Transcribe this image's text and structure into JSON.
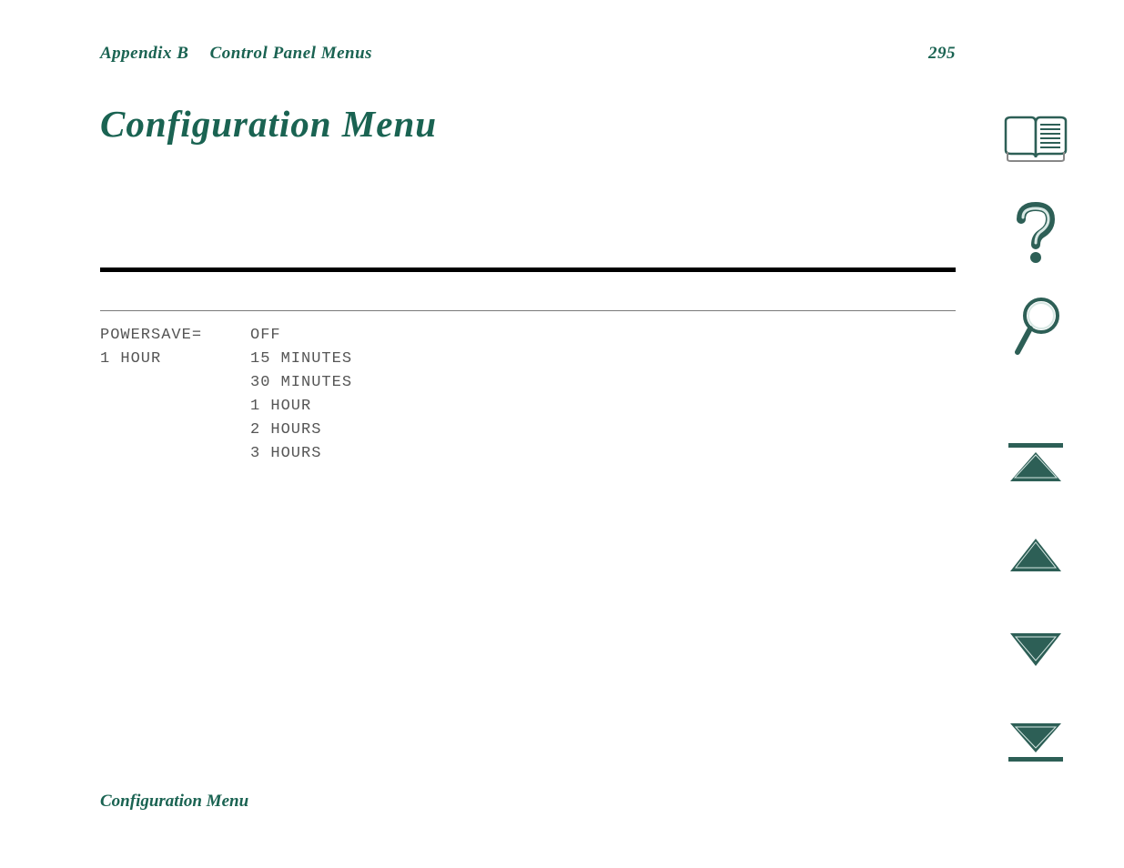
{
  "header": {
    "appendix": "Appendix B",
    "chapter": "Control Panel Menus",
    "page_number": "295"
  },
  "title": "Configuration Menu",
  "menu": {
    "setting_name": "POWERSAVE=",
    "current_value": "1 HOUR",
    "options": [
      "OFF",
      "15 MINUTES",
      "30 MINUTES",
      "1 HOUR",
      "2 HOURS",
      "3 HOURS"
    ]
  },
  "footer": "Configuration Menu",
  "nav": {
    "book": "contents-icon",
    "help": "help-icon",
    "search": "search-icon",
    "first": "first-page-icon",
    "prev": "previous-page-icon",
    "next": "next-page-icon",
    "last": "last-page-icon"
  },
  "colors": {
    "accent": "#1a6352",
    "icon_fill": "#2d5f56",
    "icon_light": "#d8e8e4"
  }
}
